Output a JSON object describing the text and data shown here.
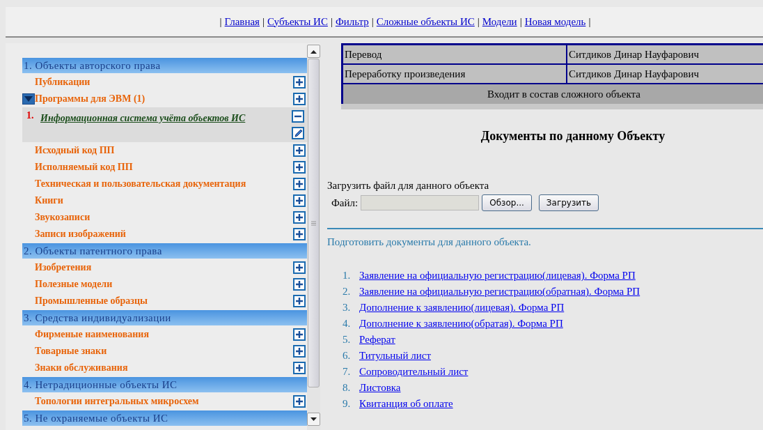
{
  "nav": [
    {
      "kind": "separator",
      "text": "|"
    },
    {
      "kind": "link",
      "text": "Главная"
    },
    {
      "kind": "separator",
      "text": "|"
    },
    {
      "kind": "link",
      "text": "Субъекты ИС"
    },
    {
      "kind": "separator",
      "text": "|"
    },
    {
      "kind": "link",
      "text": "Фильтр"
    },
    {
      "kind": "separator",
      "text": "|"
    },
    {
      "kind": "link",
      "text": "Сложные объекты ИС"
    },
    {
      "kind": "separator",
      "text": "|"
    },
    {
      "kind": "link",
      "text": "Модели"
    },
    {
      "kind": "separator",
      "text": "|"
    },
    {
      "kind": "link",
      "text": "Новая модель"
    },
    {
      "kind": "separator",
      "text": "|"
    }
  ],
  "tree": [
    {
      "title": "1. Объекты авторского права",
      "items": [
        {
          "label": "Публикации",
          "expanded": false
        },
        {
          "label": "Программы для ЭВМ (1)",
          "expanded": true,
          "children": [
            {
              "number": "1.",
              "label": "Информационная система учёта объектов ИС"
            }
          ]
        },
        {
          "label": "Исходный код ПП",
          "expanded": false
        },
        {
          "label": "Исполняемый код ПП",
          "expanded": false
        },
        {
          "label": "Техническая и пользовательская документация",
          "expanded": false
        },
        {
          "label": "Книги",
          "expanded": false
        },
        {
          "label": "Звукозаписи",
          "expanded": false
        },
        {
          "label": "Записи изображений",
          "expanded": false
        }
      ]
    },
    {
      "title": "2. Объекты патентного права",
      "items": [
        {
          "label": "Изобретения",
          "expanded": false
        },
        {
          "label": "Полезные модели",
          "expanded": false
        },
        {
          "label": "Промышленные образцы",
          "expanded": false
        }
      ]
    },
    {
      "title": "3. Средства индивидуализации",
      "items": [
        {
          "label": "Фирменые наименования",
          "expanded": false
        },
        {
          "label": "Товарные знаки",
          "expanded": false
        },
        {
          "label": "Знаки обслуживания",
          "expanded": false
        }
      ]
    },
    {
      "title": "4. Нетрадиционные объекты ИС",
      "items": [
        {
          "label": "Топологии интегральных микросхем",
          "expanded": false
        }
      ]
    },
    {
      "title": "5. Не охраняемые объекты ИС"
    }
  ],
  "table": {
    "rows": [
      {
        "cells": [
          "Перевод",
          "Ситдиков Динар Науфарович"
        ]
      },
      {
        "cells": [
          "Переработку произведения",
          "Ситдиков Динар Науфарович"
        ]
      }
    ],
    "footer": "Входит в состав сложного объекта"
  },
  "documents_heading": "Документы по данному Объекту",
  "upload": {
    "title": "Загрузить файл для данного объекта",
    "label": "Файл:",
    "browse_button": "Обзор...",
    "upload_button": "Загрузить"
  },
  "prepare_text": "Подготовить документы для данного объекта.",
  "documents": [
    {
      "number": "1.",
      "label": "Заявление на официальную регистрацию(лицевая). Форма РП"
    },
    {
      "number": "2.",
      "label": "Заявление на официальную регистрацию(обратная). Форма РП"
    },
    {
      "number": "3.",
      "label": "Дополнение к заявлению(лицевая). Форма РП"
    },
    {
      "number": "4.",
      "label": "Дополнение к заявлению(обратая). Форма РП"
    },
    {
      "number": "5.",
      "label": "Реферат"
    },
    {
      "number": "6.",
      "label": "Титульный лист"
    },
    {
      "number": "7.",
      "label": "Сопроводительный лист"
    },
    {
      "number": "8.",
      "label": "Листовка"
    },
    {
      "number": "9.",
      "label": "Квитанция об оплате"
    }
  ]
}
